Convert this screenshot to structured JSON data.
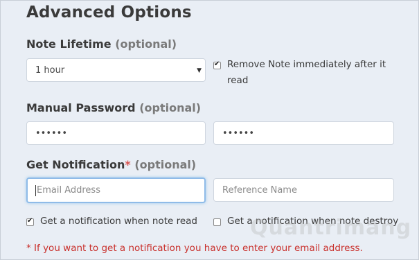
{
  "title": "Advanced Options",
  "note_lifetime": {
    "label": "Note Lifetime",
    "optional": "(optional)",
    "select_value": "1 hour",
    "remove_label": "Remove Note immediately after it",
    "remove_label_2": "read",
    "remove_checked": true
  },
  "manual_password": {
    "label": "Manual Password",
    "optional": "(optional)",
    "password_value": "••••••",
    "confirm_value": "••••••"
  },
  "notification": {
    "label": "Get Notification",
    "required_mark": "*",
    "optional": "(optional)",
    "email_placeholder": "Email Address",
    "reference_placeholder": "Reference Name",
    "on_read_label": "Get a notification when note read",
    "on_read_checked": true,
    "on_destroy_label": "Get a notification when note destroy",
    "on_destroy_checked": false,
    "warning": "* If you want to get a notification you have to enter your email address."
  },
  "watermark": "Quantrimang",
  "colors": {
    "background": "#e9eef5",
    "warning": "#c9302c",
    "focus_border": "#8fbbe8"
  }
}
